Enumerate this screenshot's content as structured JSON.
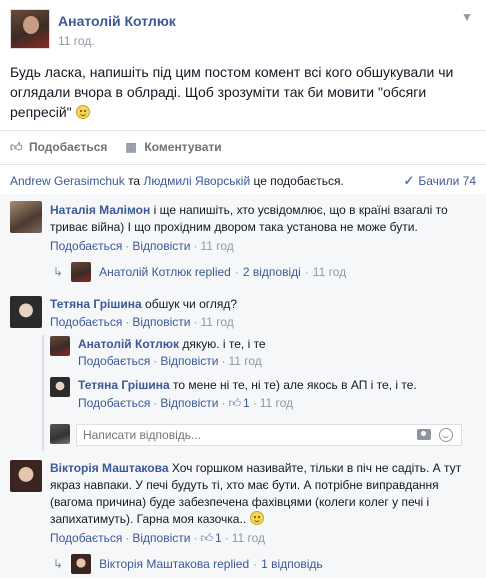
{
  "post": {
    "author": "Анатолій Котлюк",
    "time": "11 год.",
    "text_before_emoji": "Будь ласка, напишіть під цим постом комент всі кого обшукували чи оглядали вчора в облраді. Щоб зрозуміти так би мовити \"обсяги репресій\"",
    "actions": {
      "like": "Подобається",
      "comment": "Коментувати"
    }
  },
  "likes_bar": {
    "person1": "Andrew Gerasimchuk",
    "and": "та",
    "person2": "Людмилі Яворській",
    "suffix": "це подобається.",
    "seen_label": "Бачили 74"
  },
  "comments": [
    {
      "author": "Наталія Малімон",
      "text": "і ще напишіть, хто усвідомлює, що в країні взагалі то триває війна) І що прохідним двором така установа не може бути.",
      "like": "Подобається",
      "reply": "Відповісти",
      "time": "11 год",
      "replies_summary": {
        "author": "Анатолій Котлюк",
        "replied": "replied",
        "count": "2 відповіді",
        "time": "11 год"
      }
    },
    {
      "author": "Тетяна Грішина",
      "text": "обшук чи огляд?",
      "like": "Подобається",
      "reply": "Відповісти",
      "time": "11 год",
      "replies": [
        {
          "author": "Анатолій Котлюк",
          "text": "дякую. і те, і те",
          "like": "Подобається",
          "reply": "Відповісти",
          "time": "11 год"
        },
        {
          "author": "Тетяна Грішина",
          "text": "то мене ні те, ні те) але якось в АП і те, і те.",
          "like": "Подобається",
          "reply": "Відповісти",
          "likes_count": "1",
          "time": "11 год"
        }
      ],
      "reply_placeholder": "Написати відповідь..."
    },
    {
      "author": "Вікторія Маштакова",
      "text_before_emoji": "Хоч горшком називайте, тільки в піч не садіть. А тут якраз навпаки. У печі будуть ті, хто має бути. А потрібне виправдання (вагома причина) буде забезпечена фахівцями (колеги колег у печі і запихатимуть). Гарна моя казочка..",
      "like": "Подобається",
      "reply": "Відповісти",
      "likes_count": "1",
      "time": "11 год",
      "replies_summary": {
        "author": "Вікторія Маштакова",
        "replied": "replied",
        "count": "1 відповідь"
      }
    }
  ],
  "icons": {
    "like": "thumbs-up-icon",
    "comment": "speech-bubble-icon",
    "seen": "checkmark-icon",
    "reply_arrow": "reply-arrow-icon",
    "camera": "camera-icon",
    "sticker": "smiley-icon",
    "menu": "chevron-down-icon"
  },
  "colors": {
    "link": "#3b5998",
    "meta": "#9197a3",
    "comment_bg": "#f6f7f9"
  }
}
